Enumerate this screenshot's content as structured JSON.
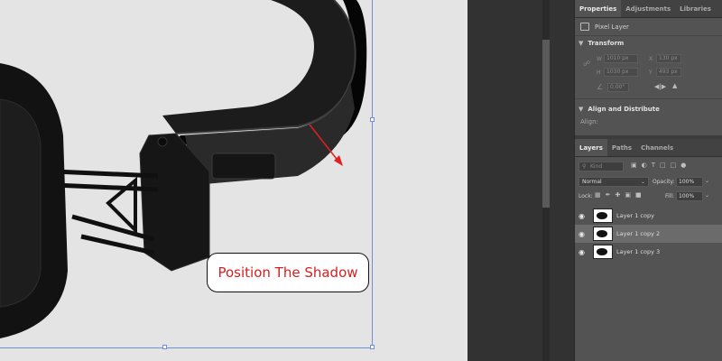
{
  "annotation": {
    "label": "Position The Shadow",
    "color": "#d42020"
  },
  "properties_panel": {
    "tabs": [
      "Properties",
      "Adjustments",
      "Libraries"
    ],
    "active_tab": "Properties",
    "layer_type": "Pixel Layer",
    "transform": {
      "title": "Transform",
      "w_label": "W",
      "w_value": "1010 px",
      "x_label": "X",
      "x_value": "130 px",
      "h_label": "H",
      "h_value": "1030 px",
      "y_label": "Y",
      "y_value": "493 px",
      "angle_value": "0.00°"
    },
    "align": {
      "title": "Align and Distribute",
      "align_label": "Align:"
    }
  },
  "layers_panel": {
    "tabs": [
      "Layers",
      "Paths",
      "Channels"
    ],
    "active_tab": "Layers",
    "kind_label": "Kind",
    "blend_mode": "Normal",
    "opacity_label": "Opacity:",
    "opacity_value": "100%",
    "lock_label": "Lock:",
    "fill_label": "Fill:",
    "fill_value": "100%",
    "layers": [
      {
        "name": "Layer 1 copy",
        "selected": false
      },
      {
        "name": "Layer 1 copy 2",
        "selected": true
      },
      {
        "name": "Layer 1 copy 3",
        "selected": false
      }
    ]
  }
}
